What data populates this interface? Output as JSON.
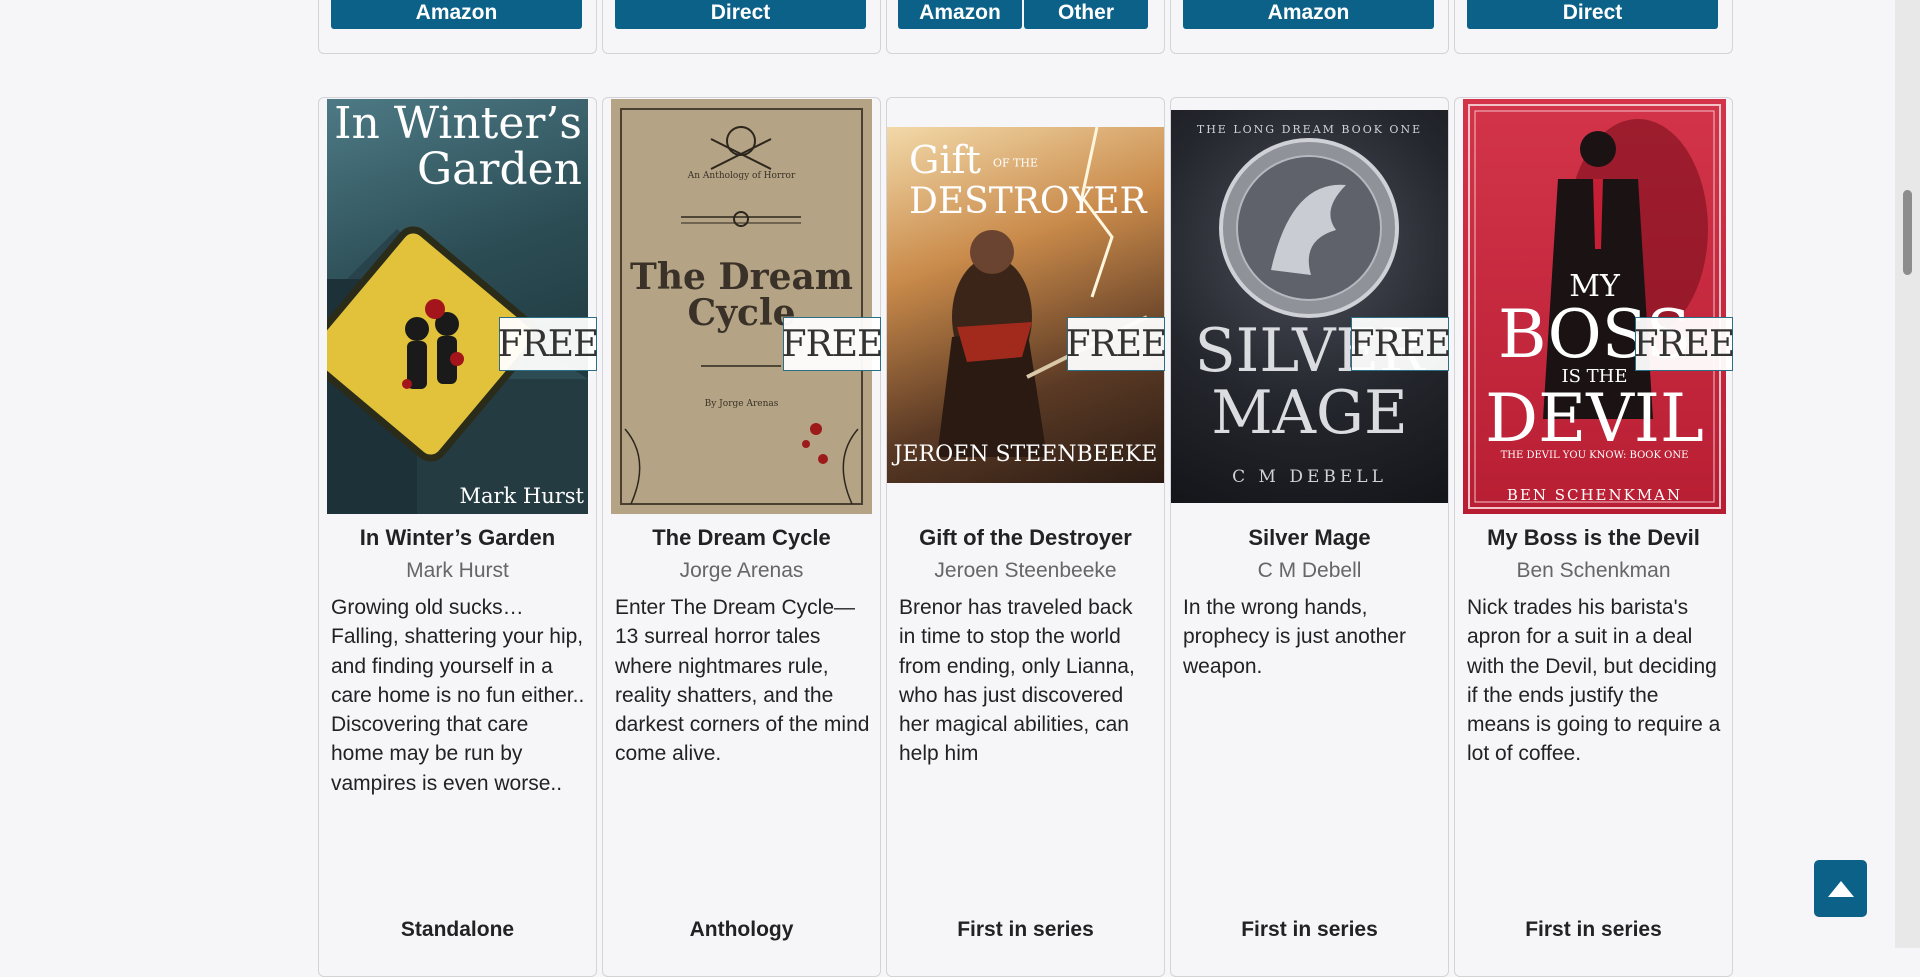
{
  "top_buttons": [
    {
      "labels": [
        "Amazon"
      ]
    },
    {
      "labels": [
        "Direct"
      ]
    },
    {
      "labels": [
        "Amazon",
        "Other"
      ]
    },
    {
      "labels": [
        "Amazon"
      ]
    },
    {
      "labels": [
        "Direct"
      ]
    }
  ],
  "free_label": "FREE",
  "books": [
    {
      "title": "In Winter’s Garden",
      "author": "Mark Hurst",
      "description": "Growing old sucks… Falling, shattering your hip, and finding yourself in a care home is no fun either.. Discovering that care home may be run by vampires is even worse..",
      "series": "Standalone",
      "cover": {
        "line1": "In Winter’s",
        "line2": "Garden",
        "author": "Mark Hurst"
      }
    },
    {
      "title": "The Dream Cycle",
      "author": "Jorge Arenas",
      "description": "Enter The Dream Cycle—13 surreal horror tales where nightmares rule, reality shatters, and the darkest corners of the mind come alive.",
      "series": "Anthology",
      "cover": {
        "kicker": "An Anthology of Horror",
        "line1": "The Dream",
        "line2": "Cycle",
        "author": "By Jorge Arenas"
      }
    },
    {
      "title": "Gift of the Destroyer",
      "author": "Jeroen Steenbeeke",
      "description": "Brenor has traveled back in time to stop the world from ending, only Lianna, who has just discovered her magical abilities, can help him",
      "series": "First in series",
      "cover": {
        "line1": "Gift",
        "line1b": "OF THE",
        "line2": "DESTROYER",
        "author": "JEROEN STEENBEEKE"
      }
    },
    {
      "title": "Silver Mage",
      "author": "C M Debell",
      "description": "In the wrong hands, prophecy is just another weapon.",
      "series": "First in series",
      "cover": {
        "kicker": "THE LONG DREAM BOOK ONE",
        "line1": "SILVER",
        "line2": "MAGE",
        "author": "C M DEBELL"
      }
    },
    {
      "title": "My Boss is the Devil",
      "author": "Ben Schenkman",
      "description": "Nick trades his barista's apron for a suit in a deal with the Devil, but deciding if the ends justify the means is going to require a lot of coffee.",
      "series": "First in series",
      "cover": {
        "line1": "MY",
        "line2": "BOSS",
        "line3": "IS THE",
        "line4": "DEVIL",
        "kicker": "THE DEVIL YOU KNOW: BOOK ONE",
        "author": "BEN SCHENKMAN"
      }
    }
  ],
  "colors": {
    "accent": "#0b6187",
    "background": "#f6f6f9"
  },
  "icons": {
    "back_to_top": "arrow-up-icon"
  }
}
